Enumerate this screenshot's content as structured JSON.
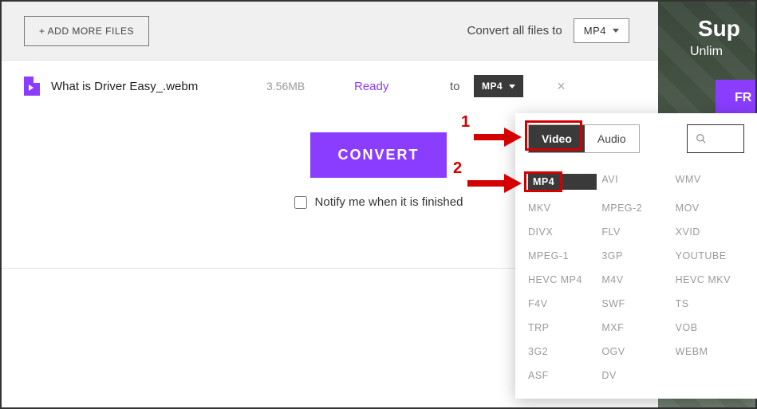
{
  "topbar": {
    "add_more_label": "+ ADD MORE FILES",
    "convert_all_label": "Convert all files to",
    "global_format": "MP4"
  },
  "file": {
    "name": "What is Driver Easy_.webm",
    "size": "3.56MB",
    "status": "Ready",
    "to_label": "to",
    "target_format": "MP4",
    "remove_glyph": "×"
  },
  "actions": {
    "convert_label": "CONVERT",
    "notify_label": "Notify me when it is finished"
  },
  "dropdown": {
    "tabs": {
      "video": "Video",
      "audio": "Audio"
    },
    "formats": {
      "col1": [
        "MP4",
        "MKV",
        "DIVX",
        "MPEG-1",
        "HEVC MP4",
        "F4V",
        "TRP",
        "3G2",
        "ASF"
      ],
      "col2": [
        "AVI",
        "MPEG-2",
        "FLV",
        "3GP",
        "M4V",
        "SWF",
        "MXF",
        "OGV",
        "DV"
      ],
      "col3": [
        "WMV",
        "MOV",
        "XVID",
        "YOUTUBE",
        "HEVC MKV",
        "TS",
        "VOB",
        "WEBM"
      ]
    }
  },
  "ad": {
    "title": "Sup",
    "subtitle": "Unlim",
    "button": "FR"
  },
  "annotations": {
    "one": "1",
    "two": "2"
  }
}
